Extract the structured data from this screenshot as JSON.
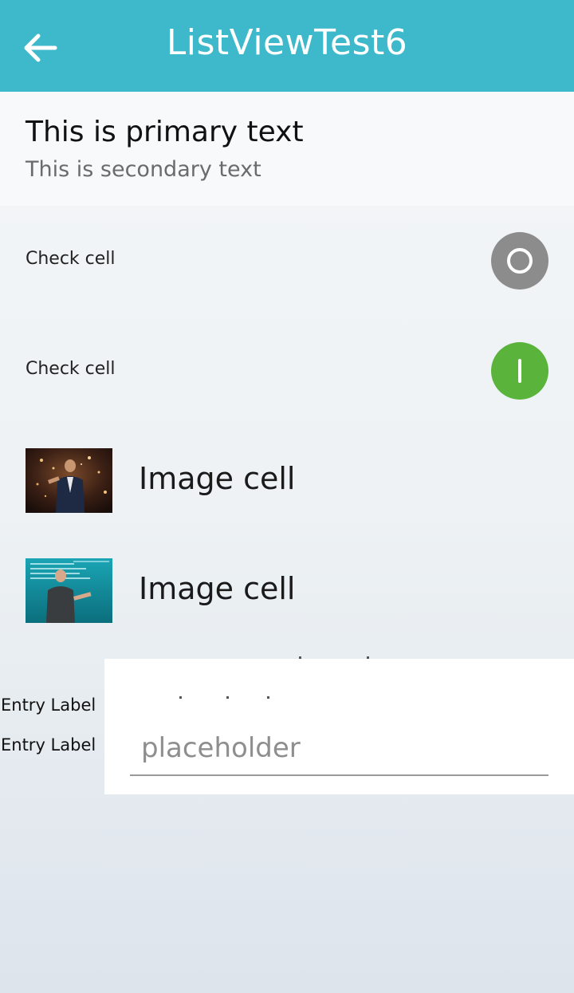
{
  "header": {
    "title": "ListViewTest6",
    "back_icon": "arrow-left-icon",
    "color": "#3eb9cb"
  },
  "text_cell": {
    "primary": "This is primary text",
    "secondary": "This is secondary text"
  },
  "check_cells": [
    {
      "label": "Check cell",
      "state": "off",
      "color": "#8c8c8c"
    },
    {
      "label": "Check cell",
      "state": "on",
      "color": "#5ab33a"
    }
  ],
  "image_cells": [
    {
      "label": "Image cell",
      "thumbnail": "speaker-on-stage-photo"
    },
    {
      "label": "Image cell",
      "thumbnail": "speaker-teal-background-photo"
    }
  ],
  "entry": {
    "labels": [
      "Entry Label",
      "Entry Label"
    ],
    "placeholder": "placeholder",
    "value": ""
  }
}
